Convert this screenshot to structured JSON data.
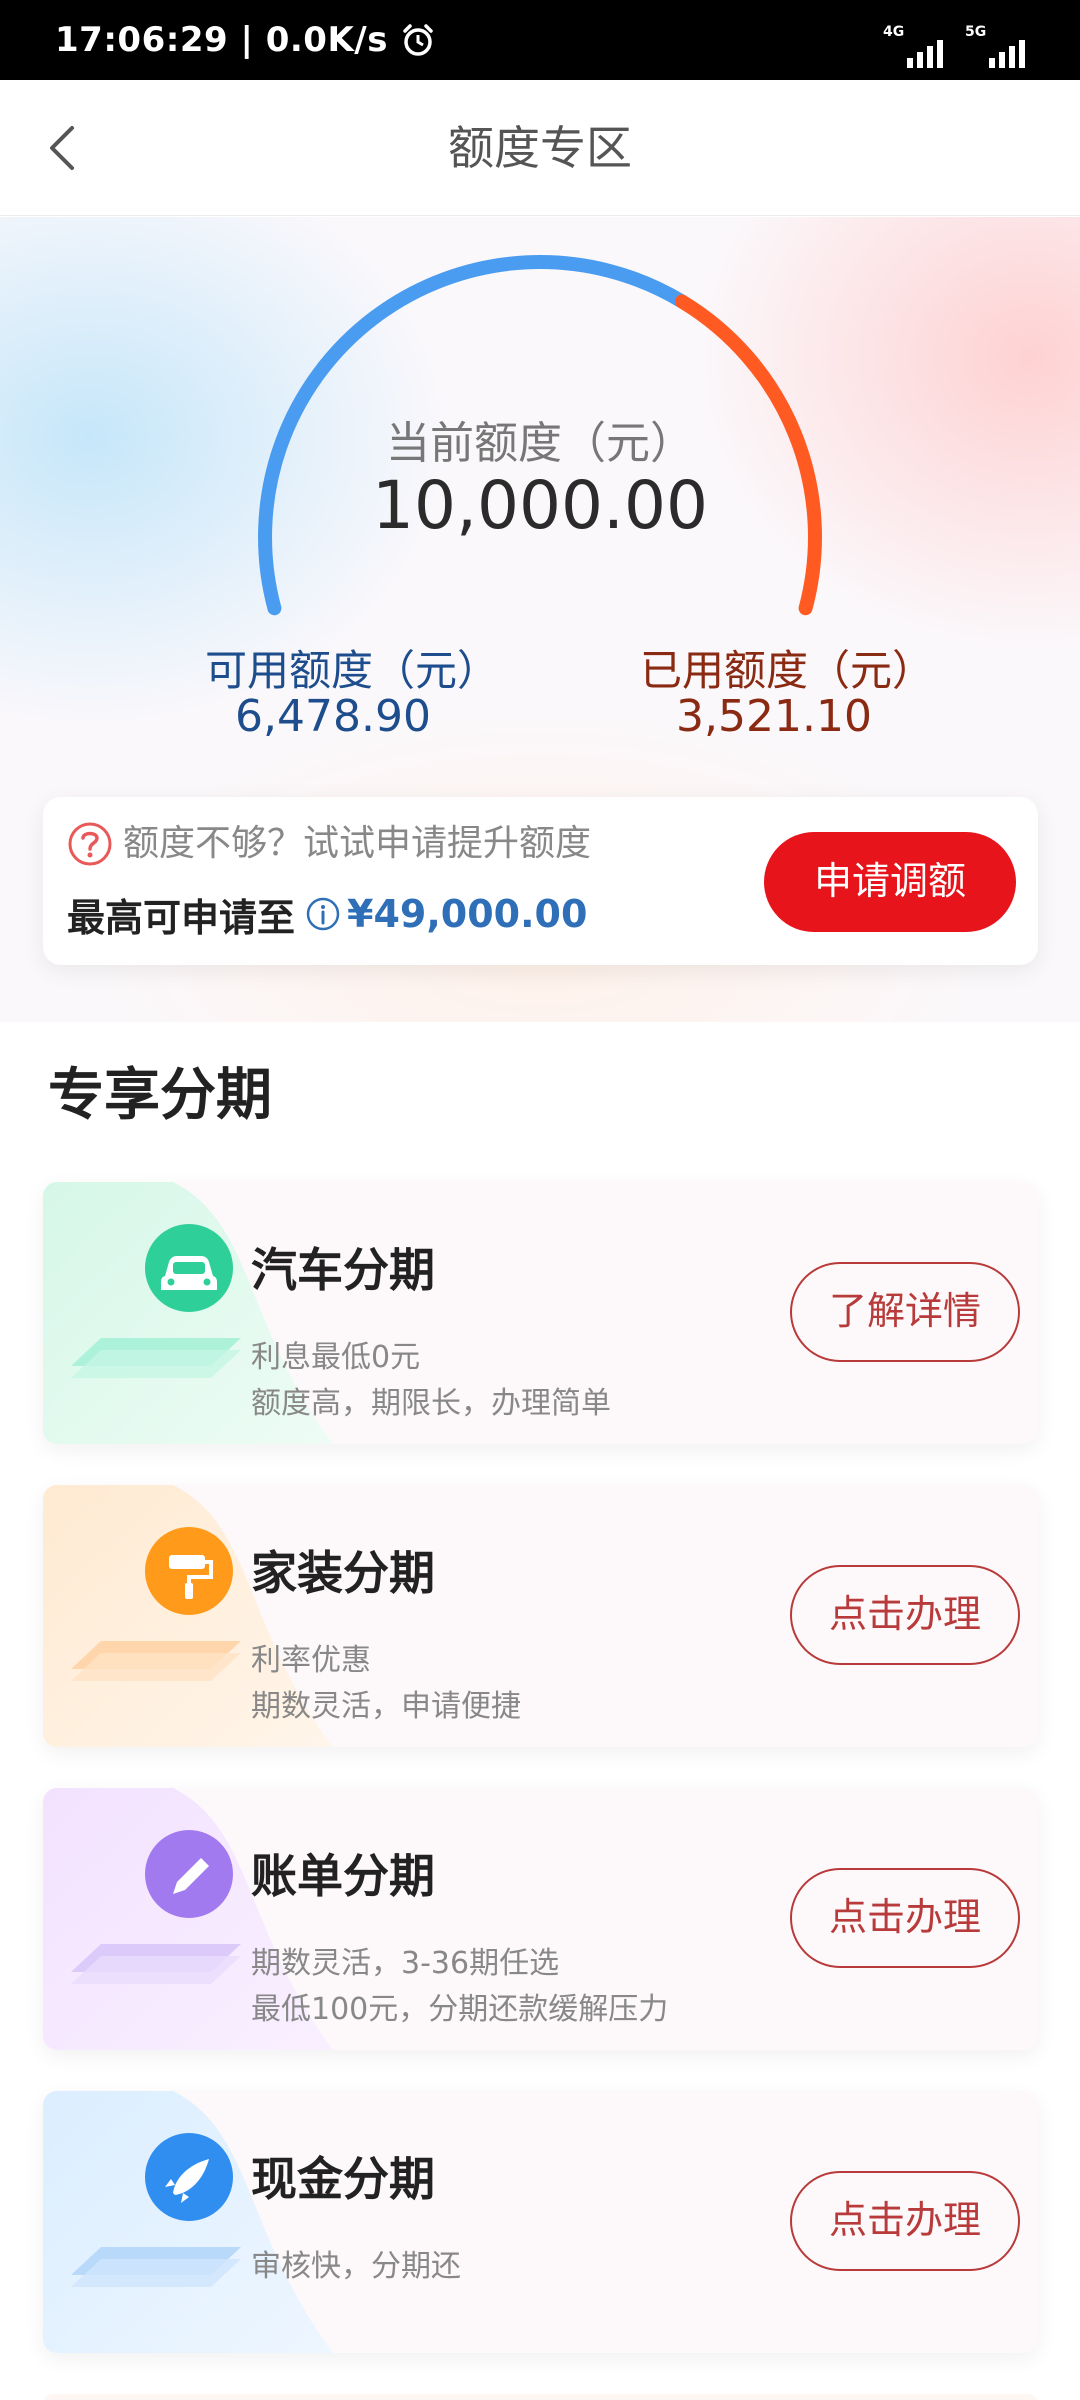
{
  "status_bar": {
    "time": "17:06:29 | 0.0K/s",
    "network_1": "4G",
    "network_2": "5G"
  },
  "nav": {
    "title": "额度专区"
  },
  "gauge": {
    "label": "当前额度（元）",
    "value": "10,000.00",
    "used_fraction": 0.352,
    "available_color": "#4a9cf0",
    "used_color": "#ff5a22"
  },
  "available": {
    "label": "可用额度（元）",
    "value": "6,478.90"
  },
  "used": {
    "label": "已用额度（元）",
    "value": "3,521.10"
  },
  "raise": {
    "hint": "额度不够？试试申请提升额度",
    "max_label": "最高可申请至",
    "max_amount": "¥49,000.00",
    "button": "申请调额"
  },
  "section": {
    "title": "专享分期"
  },
  "cards": [
    {
      "title": "汽车分期",
      "desc1": "利息最低0元",
      "desc2": "额度高，期限长，办理简单",
      "button": "了解详情",
      "icon": "car-icon",
      "accent": "#2fcf9a"
    },
    {
      "title": "家装分期",
      "desc1": "利率优惠",
      "desc2": "期数灵活，申请便捷",
      "button": "点击办理",
      "icon": "paint-roller-icon",
      "accent": "#ff9a1a"
    },
    {
      "title": "账单分期",
      "desc1": "期数灵活，3-36期任选",
      "desc2": "最低100元，分期还款缓解压力",
      "button": "点击办理",
      "icon": "pen-icon",
      "accent": "#a27af0"
    },
    {
      "title": "现金分期",
      "desc1": "审核快，分期还",
      "desc2": "",
      "button": "点击办理",
      "icon": "rocket-icon",
      "accent": "#2f8ef0"
    }
  ]
}
